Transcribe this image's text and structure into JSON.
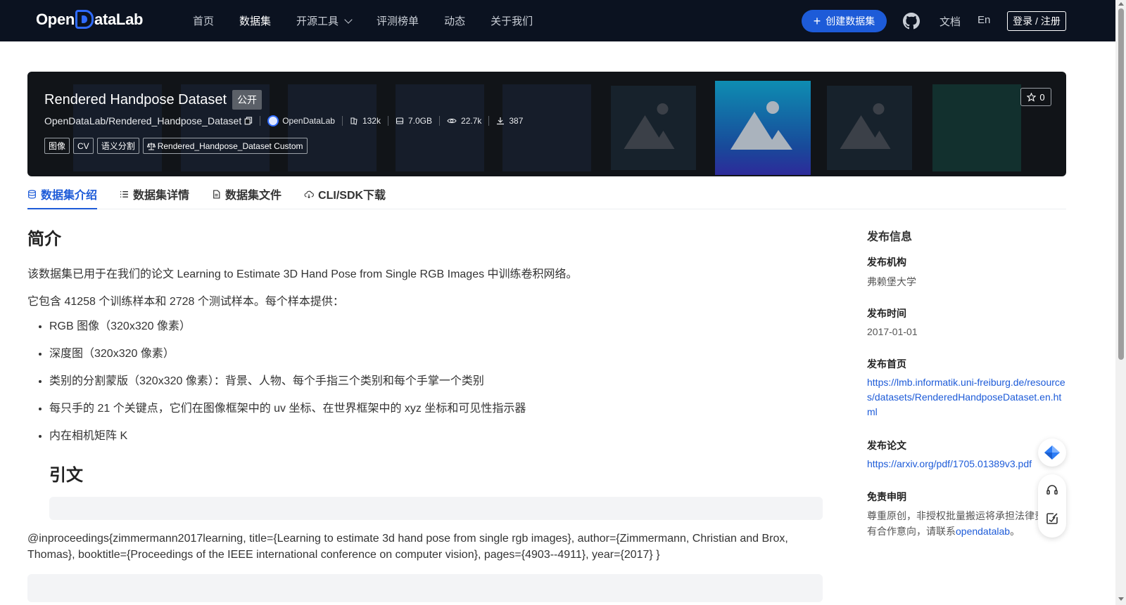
{
  "brand": {
    "logo_left": "Open",
    "logo_right": "ataLab",
    "accent": "#1d5bd8"
  },
  "nav": {
    "items": [
      {
        "label": "首页"
      },
      {
        "label": "数据集"
      },
      {
        "label": "开源工具"
      },
      {
        "label": "评测榜单"
      },
      {
        "label": "动态"
      },
      {
        "label": "关于我们"
      }
    ],
    "create_label": "创建数据集",
    "doc_label": "文档",
    "lang_label": "En",
    "login_label": "登录 / 注册"
  },
  "dataset": {
    "title": "Rendered Handpose Dataset",
    "visibility": "公开",
    "repo": "OpenDataLab/Rendered_Handpose_Dataset",
    "org": "OpenDataLab",
    "files": "132k",
    "size": "7.0GB",
    "views": "22.7k",
    "downloads": "387",
    "tags": [
      "图像",
      "CV",
      "语义分割"
    ],
    "license": "Rendered_Handpose_Dataset Custom",
    "stars": "0"
  },
  "tabs": [
    {
      "label": "数据集介绍"
    },
    {
      "label": "数据集详情"
    },
    {
      "label": "数据集文件"
    },
    {
      "label": "CLI/SDK下载"
    }
  ],
  "content": {
    "intro_heading": "简介",
    "p1": "该数据集已用于在我们的论文 Learning to Estimate 3D Hand Pose from Single RGB Images 中训练卷积网络。",
    "p2": "它包含 41258 个训练样本和 2728 个测试样本。每个样本提供：",
    "bullets": [
      "RGB 图像（320x320 像素）",
      "深度图（320x320 像素）",
      "类别的分割蒙版（320x320 像素）：背景、人物、每个手指三个类别和每个手掌一个类别",
      "每只手的 21 个关键点，它们在图像框架中的 uv 坐标、在世界框架中的 xyz 坐标和可见性指示器",
      "内在相机矩阵 K"
    ],
    "cite_heading": "引文",
    "bibtex": "@inproceedings{zimmermann2017learning, title={Learning to estimate 3d hand pose from single rgb images}, author={Zimmermann, Christian and Brox, Thomas}, booktitle={Proceedings of the IEEE international conference on computer vision}, pages={4903--4911}, year={2017} }"
  },
  "sidebar": {
    "heading": "发布信息",
    "org_label": "发布机构",
    "org_value": "弗赖堡大学",
    "date_label": "发布时间",
    "date_value": "2017-01-01",
    "home_label": "发布首页",
    "home_url": "https://lmb.informatik.uni-freiburg.de/resources/datasets/RenderedHandposeDataset.en.html",
    "paper_label": "发布论文",
    "paper_url": "https://arxiv.org/pdf/1705.01389v3.pdf",
    "disclaimer_label": "免责申明",
    "disclaimer_text": "尊重原创，非授权批量搬运将承担法律责任如有合作意向，请联系",
    "disclaimer_link": "opendatalab",
    "disclaimer_end": "。"
  }
}
